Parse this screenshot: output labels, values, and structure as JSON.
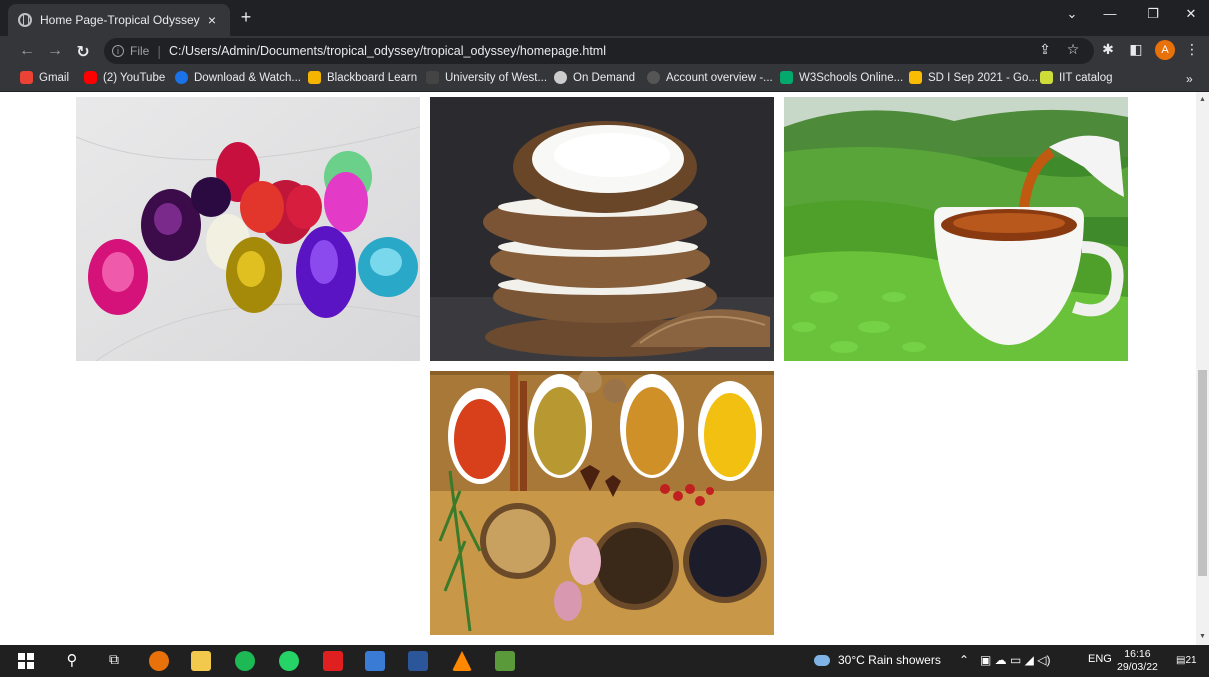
{
  "browser": {
    "tab_title": "Home Page-Tropical Odyssey",
    "tab_close": "×",
    "new_tab": "+",
    "file_label": "File",
    "url": "C:/Users/Admin/Documents/tropical_odyssey/tropical_odyssey/homepage.html",
    "avatar_letter": "A"
  },
  "bookmarks": [
    {
      "label": "Gmail",
      "color": "#ea4335"
    },
    {
      "label": "(2) YouTube",
      "color": "#ff0000"
    },
    {
      "label": "Download & Watch...",
      "color": "#1a73e8"
    },
    {
      "label": "Blackboard Learn",
      "color": "#f4b400"
    },
    {
      "label": "University of West...",
      "color": "#444444"
    },
    {
      "label": "On Demand",
      "color": "#cccccc"
    },
    {
      "label": "Account overview -...",
      "color": "#555555"
    },
    {
      "label": "W3Schools Online...",
      "color": "#04aa6d"
    },
    {
      "label": "SD I Sep 2021 - Go...",
      "color": "#fbbc04"
    },
    {
      "label": "IIT catalog",
      "color": "#cddc39"
    }
  ],
  "gallery": [
    {
      "name": "gemstones-image",
      "subject": "gemstones"
    },
    {
      "name": "coconut-image",
      "subject": "coconut"
    },
    {
      "name": "tea-image",
      "subject": "tea"
    },
    {
      "name": "spices-image",
      "subject": "spices"
    }
  ],
  "taskbar": {
    "weather": "30°C  Rain showers",
    "lang": "ENG",
    "time": "16:16",
    "date": "29/03/22",
    "notif_count": "21"
  }
}
